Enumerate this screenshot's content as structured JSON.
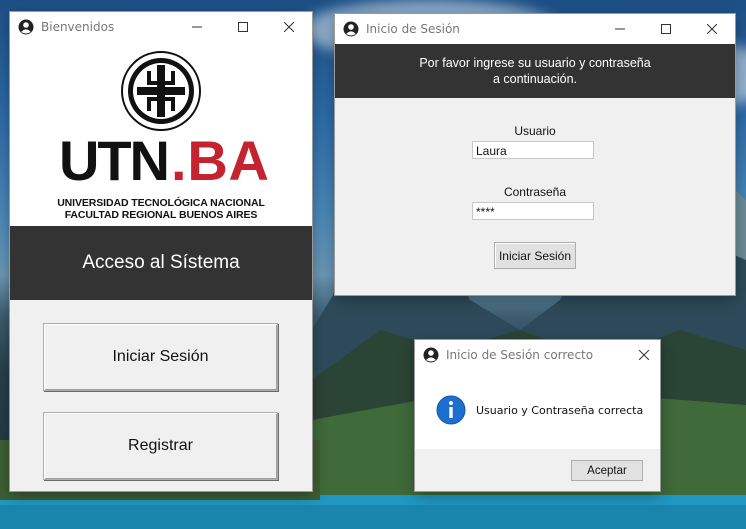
{
  "windows": {
    "welcome": {
      "title": "Bienvenidos",
      "logo": {
        "wordmark": "UTN.BA",
        "line1": "UNIVERSIDAD TECNOLÓGICA NACIONAL",
        "line2": "FACULTAD REGIONAL BUENOS AIRES"
      },
      "banner": "Acceso al Sístema",
      "buttons": {
        "login": "Iniciar Sesión",
        "register": "Registrar"
      }
    },
    "login": {
      "title": "Inicio de Sesión",
      "header_line1": "Por favor ingrese su usuario y contraseña",
      "header_line2": "a continuación.",
      "user_label": "Usuario",
      "user_value": "Laura",
      "password_label": "Contraseña",
      "password_value": "****",
      "submit": "Iniciar Sesión"
    },
    "message": {
      "title": "Inicio de Sesión correcto",
      "text": "Usuario y Contraseña correcta",
      "ok": "Aceptar"
    }
  },
  "colors": {
    "brand_red": "#c4232f",
    "dark_banner": "#333333",
    "info_blue": "#1c6fd1"
  },
  "icons": {
    "window_icon": "user-account-icon",
    "info": "info-icon"
  }
}
